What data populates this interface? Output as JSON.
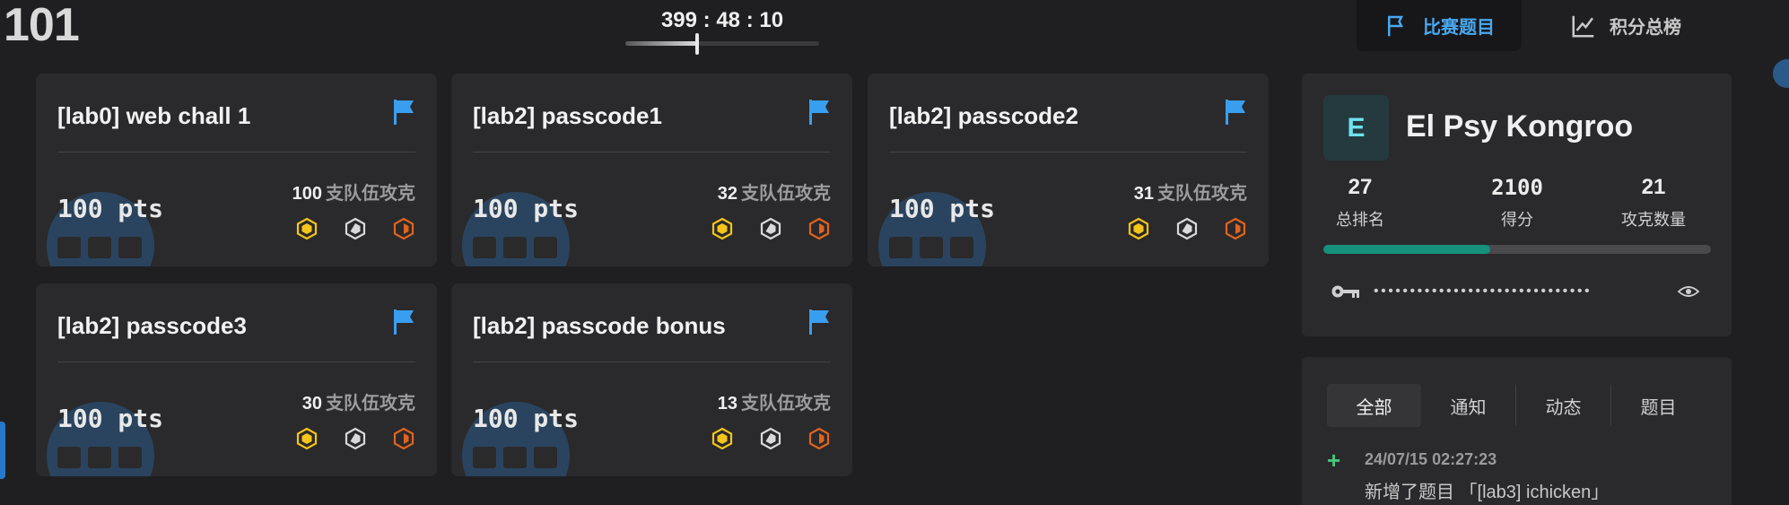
{
  "game": {
    "title": "101"
  },
  "timer": {
    "text": "399 : 48 : 10",
    "progress": 0.37
  },
  "nav": {
    "challenges_label": "比赛题目",
    "scoreboard_label": "积分总榜"
  },
  "challenges": [
    {
      "title": "[lab0] web chall 1",
      "points": "100 pts",
      "solves": "100",
      "solves_suffix": "支队伍攻克"
    },
    {
      "title": "[lab2] passcode1",
      "points": "100 pts",
      "solves": "32",
      "solves_suffix": "支队伍攻克"
    },
    {
      "title": "[lab2] passcode2",
      "points": "100 pts",
      "solves": "31",
      "solves_suffix": "支队伍攻克"
    },
    {
      "title": "[lab2] passcode3",
      "points": "100 pts",
      "solves": "30",
      "solves_suffix": "支队伍攻克"
    },
    {
      "title": "[lab2] passcode bonus",
      "points": "100 pts",
      "solves": "13",
      "solves_suffix": "支队伍攻克"
    }
  ],
  "colors": {
    "accent": "#4aa8f0",
    "gold": "#f5c518",
    "silver": "#d9d9d9",
    "bronze": "#e0641e",
    "progress": "#15917c"
  },
  "team": {
    "avatar_letter": "E",
    "name": "El Psy Kongroo",
    "rank": "27",
    "rank_label": "总排名",
    "score": "2100",
    "score_label": "得分",
    "solved": "21",
    "solved_label": "攻克数量",
    "progress": 0.43,
    "token_mask": "••••••••••••••••••••••••••••••"
  },
  "notices": {
    "tabs": [
      "全部",
      "通知",
      "动态",
      "题目"
    ],
    "active_tab": "全部",
    "items": [
      {
        "time": "24/07/15 02:27:23",
        "message": "新增了题目 「[lab3] ichicken」"
      }
    ]
  }
}
